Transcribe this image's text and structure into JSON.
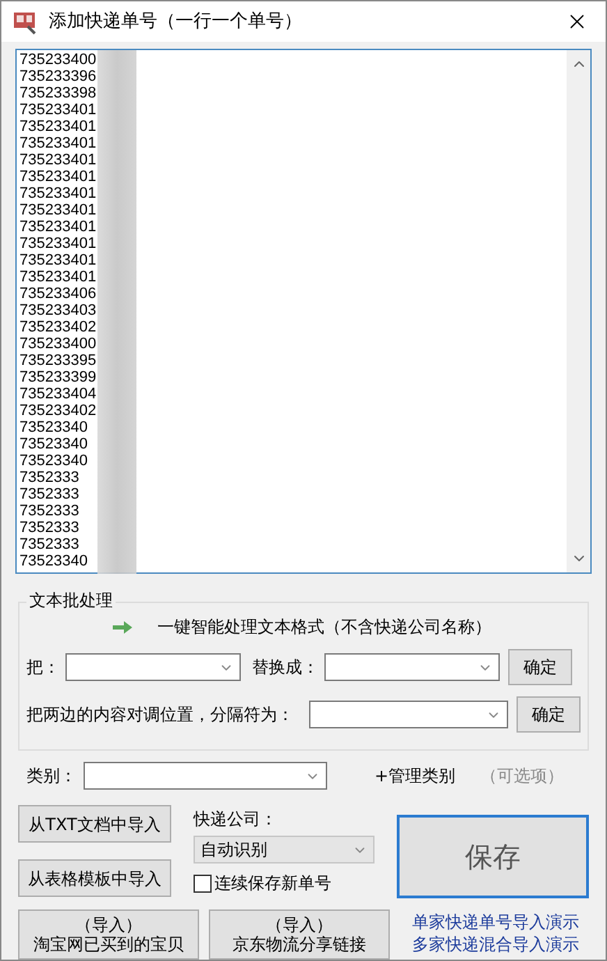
{
  "window": {
    "title": "添加快递单号（一行一个单号）"
  },
  "numbers": [
    "735233400",
    "735233396",
    "735233398",
    "735233401",
    "735233401",
    "735233401",
    "735233401",
    "735233401",
    "735233401",
    "735233401",
    "735233401",
    "735233401",
    "735233401",
    "735233401",
    "735233406",
    "735233403",
    "735233402",
    "735233400",
    "735233395",
    "735233399",
    "735233404",
    "735233402",
    "73523340",
    "73523340",
    "73523340",
    "7352333",
    "7352333",
    "7352333",
    "7352333",
    "7352333",
    "73523340"
  ],
  "batch": {
    "title": "文本批处理",
    "smart_action": "一键智能处理文本格式（不含快递公司名称）",
    "replace_label": "把：",
    "replace_with_label": "替换成：",
    "replace_button": "确定",
    "swap_label": "把两边的内容对调位置，分隔符为：",
    "swap_button": "确定"
  },
  "category": {
    "label": "类别：",
    "manage_link": "+管理类别",
    "hint": "（可选项）"
  },
  "import_txt": "从TXT文档中导入",
  "import_table": "从表格模板中导入",
  "courier": {
    "label": "快递公司：",
    "value": "自动识别"
  },
  "continuous": {
    "label": "连续保存新单号",
    "checked": false
  },
  "save": "保存",
  "imports": [
    {
      "line1": "（导入）",
      "line2": "淘宝网已买到的宝贝"
    },
    {
      "line1": "（导入）",
      "line2": "京东物流分享链接"
    }
  ],
  "demo_links": [
    "单家快递单号导入演示",
    "多家快递混合导入演示"
  ]
}
